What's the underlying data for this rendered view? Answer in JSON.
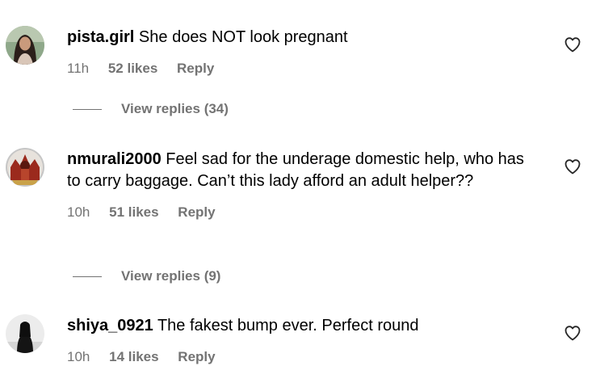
{
  "comments": [
    {
      "username": "pista.girl",
      "text": "She does NOT look pregnant",
      "time": "11h",
      "likes": "52 likes",
      "reply": "Reply",
      "view_replies": "View replies (34)",
      "avatar_icon": "profile-photo-woman"
    },
    {
      "username": "nmurali2000",
      "text": "Feel sad for the underage domestic help, who has to carry baggage. Can’t this lady afford an adult helper??",
      "time": "10h",
      "likes": "51 likes",
      "reply": "Reply",
      "view_replies": "View replies (9)",
      "avatar_icon": "profile-photo-deity"
    },
    {
      "username": "shiya_0921",
      "text": "The fakest bump ever. Perfect round",
      "time": "10h",
      "likes": "14 likes",
      "reply": "Reply",
      "avatar_icon": "profile-photo-silhouette"
    }
  ],
  "icons": {
    "like": "heart-outline-icon"
  },
  "colors": {
    "text": "#000000",
    "secondary": "#737373",
    "background": "#ffffff"
  }
}
